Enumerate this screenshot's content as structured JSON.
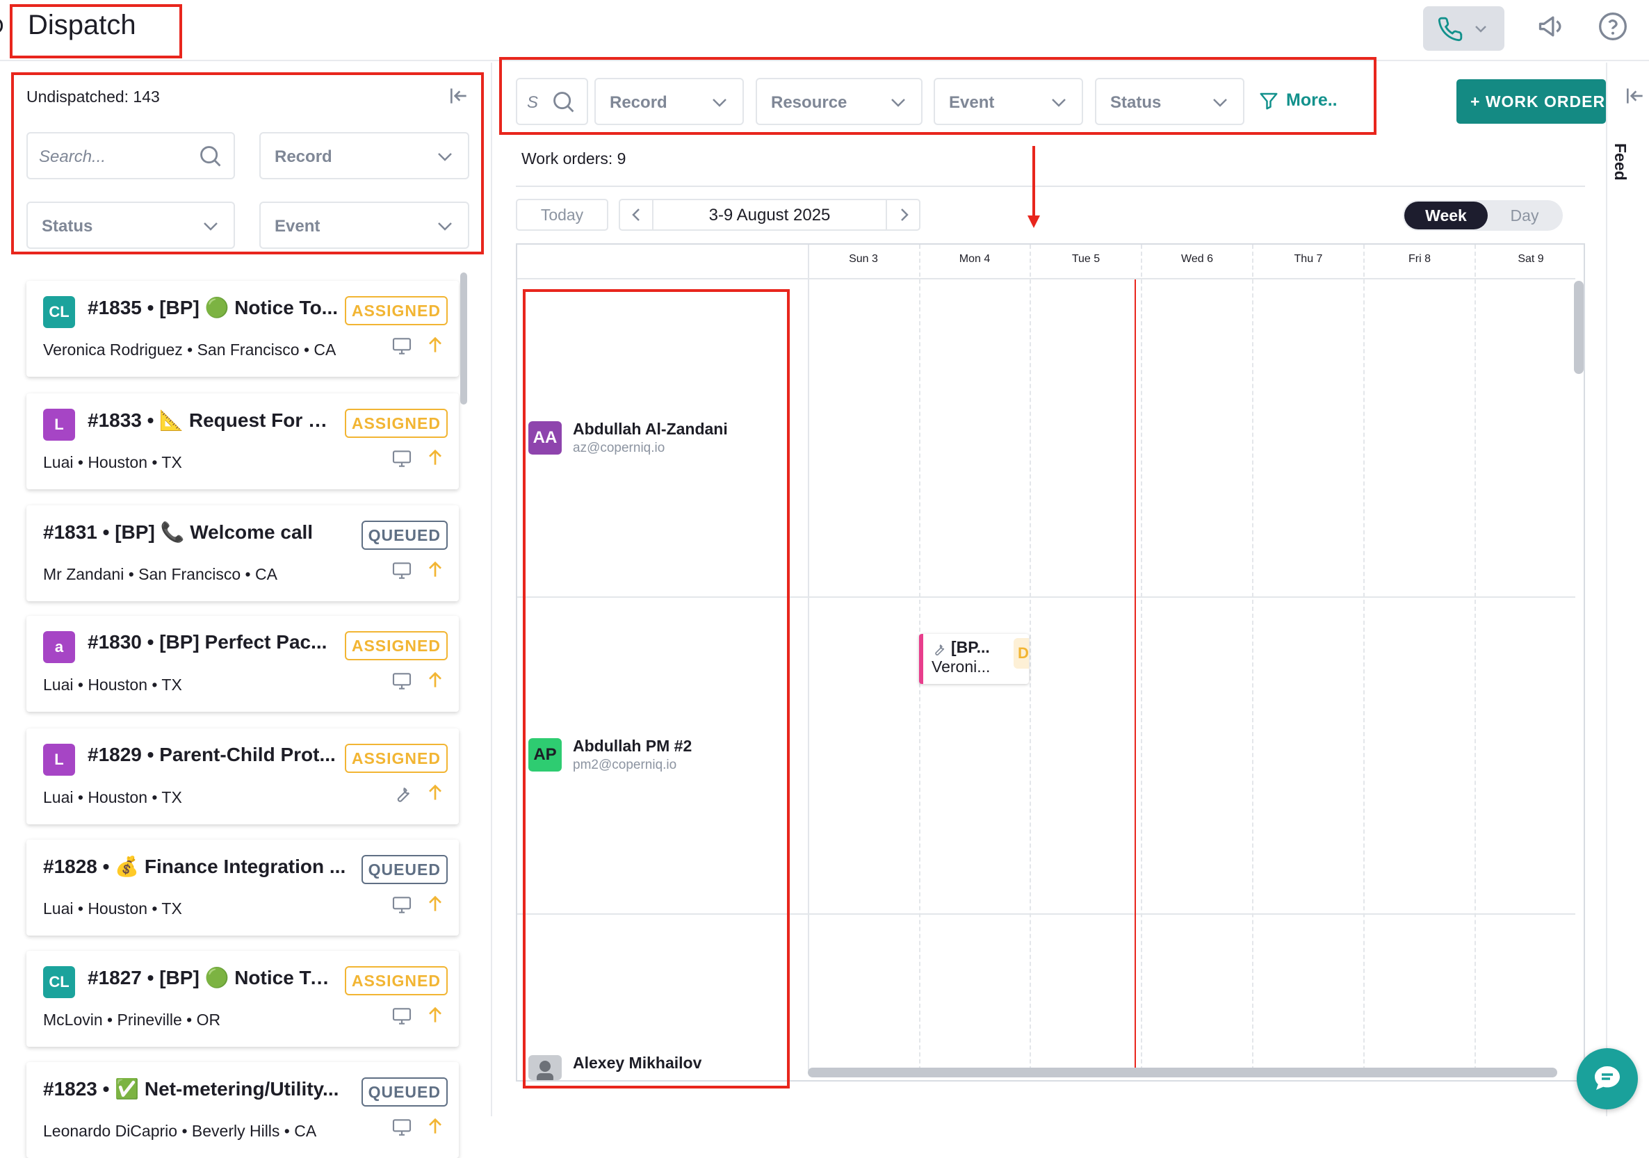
{
  "header": {
    "title": "Dispatch"
  },
  "left_panel": {
    "undispatched_label": "Undispatched: 143",
    "search_placeholder": "Search...",
    "filters": {
      "record": "Record",
      "status": "Status",
      "event": "Event"
    },
    "cards": [
      {
        "avatar": "CL",
        "avatar_color": "#1ba39c",
        "title": "#1835 • [BP] 🟢 Notice To...",
        "subtitle": "Veronica Rodriguez • San Francisco • CA",
        "status": "ASSIGNED",
        "icon": "monitor-icon"
      },
      {
        "avatar": "L",
        "avatar_color": "#a645c5",
        "title": "#1833 • 📐 Request For D...",
        "subtitle": "Luai • Houston • TX",
        "status": "ASSIGNED",
        "icon": "monitor-icon"
      },
      {
        "avatar": "",
        "avatar_color": "",
        "title": "#1831 • [BP] 📞 Welcome call",
        "subtitle": "Mr Zandani • San Francisco • CA",
        "status": "QUEUED",
        "icon": "monitor-icon"
      },
      {
        "avatar": "a",
        "avatar_color": "#a645c5",
        "title": "#1830 • [BP] Perfect Pac...",
        "subtitle": "Luai • Houston • TX",
        "status": "ASSIGNED",
        "icon": "monitor-icon"
      },
      {
        "avatar": "L",
        "avatar_color": "#a645c5",
        "title": "#1829 • Parent-Child Prot...",
        "subtitle": "Luai • Houston • TX",
        "status": "ASSIGNED",
        "icon": "wrench-icon"
      },
      {
        "avatar": "",
        "avatar_color": "",
        "title": "#1828 • 💰 Finance Integration ...",
        "subtitle": "Luai • Houston • TX",
        "status": "QUEUED",
        "icon": "monitor-icon"
      },
      {
        "avatar": "CL",
        "avatar_color": "#1ba39c",
        "title": "#1827 • [BP] 🟢 Notice To ...",
        "subtitle": "McLovin • Prineville • OR",
        "status": "ASSIGNED",
        "icon": "monitor-icon"
      },
      {
        "avatar": "",
        "avatar_color": "",
        "title": "#1823 • ✅ Net-metering/Utility...",
        "subtitle": "Leonardo DiCaprio • Beverly Hills • CA",
        "status": "QUEUED",
        "icon": "monitor-icon"
      }
    ]
  },
  "main": {
    "search_placeholder": "S",
    "filters": {
      "record": "Record",
      "resource": "Resource",
      "event": "Event",
      "status": "Status",
      "more": "More.."
    },
    "work_order_button": "+ WORK ORDER",
    "work_orders_count": "Work orders: 9",
    "today_label": "Today",
    "date_range": "3-9 August 2025",
    "view_week": "Week",
    "view_day": "Day",
    "days": [
      "Sun 3",
      "Mon 4",
      "Tue 5",
      "Wed 6",
      "Thu 7",
      "Fri 8",
      "Sat 9"
    ],
    "resources": [
      {
        "initials": "AA",
        "color": "#8e44ad",
        "name": "Abdullah Al-Zandani",
        "email": "az@coperniq.io"
      },
      {
        "initials": "AP",
        "color": "#2ecc71",
        "name": "Abdullah PM #2",
        "email": "pm2@coperniq.io"
      },
      {
        "initials": "",
        "color": "#9aa0a8",
        "name": "Alexey Mikhailov",
        "email": ""
      }
    ],
    "event": {
      "title": "[BP...",
      "subtitle": "Veroni...",
      "status_fragment": "DI"
    }
  },
  "right_rail": {
    "feed_label": "Feed"
  },
  "colors": {
    "accent": "#148a83",
    "assigned": "#f2b533",
    "queued": "#5f6f84",
    "now_line": "#e8261d",
    "highlight": "#e8261d"
  }
}
